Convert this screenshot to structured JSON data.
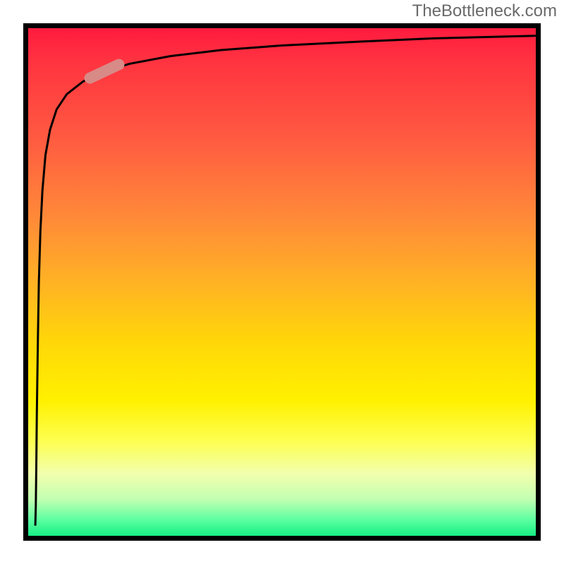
{
  "watermark": "TheBottleneck.com",
  "colors": {
    "frame": "#000000",
    "curve": "#000000",
    "marker": "#d88a87",
    "gradient_top": "#ff173e",
    "gradient_bottom": "#00e97a",
    "watermark_text": "#6a6a6a"
  },
  "chart_data": {
    "type": "line",
    "title": "",
    "xlabel": "",
    "ylabel": "",
    "xlim": [
      0,
      100
    ],
    "ylim": [
      0,
      100
    ],
    "grid": false,
    "legend": false,
    "gradient_background": {
      "direction": "vertical",
      "stops": [
        {
          "pos": 0.0,
          "color": "#ff173e"
        },
        {
          "pos": 0.07,
          "color": "#ff3240"
        },
        {
          "pos": 0.22,
          "color": "#ff5a41"
        },
        {
          "pos": 0.38,
          "color": "#ff8b38"
        },
        {
          "pos": 0.5,
          "color": "#ffb224"
        },
        {
          "pos": 0.62,
          "color": "#ffd808"
        },
        {
          "pos": 0.73,
          "color": "#fff100"
        },
        {
          "pos": 0.81,
          "color": "#fdff54"
        },
        {
          "pos": 0.87,
          "color": "#f2ffad"
        },
        {
          "pos": 0.92,
          "color": "#c2ffb2"
        },
        {
          "pos": 0.96,
          "color": "#5bffa0"
        },
        {
          "pos": 1.0,
          "color": "#00e97a"
        }
      ]
    },
    "series": [
      {
        "name": "tradeoff-curve",
        "x": [
          1.4,
          1.5,
          1.6,
          1.7,
          1.9,
          2.1,
          2.4,
          2.8,
          3.4,
          4.3,
          5.6,
          7.6,
          10.8,
          15.0,
          20.0,
          28.0,
          38.0,
          50.0,
          64.0,
          80.0,
          100.0
        ],
        "y": [
          2,
          6,
          14,
          24,
          38,
          50,
          60,
          68,
          75,
          80,
          84,
          87,
          89.5,
          91.5,
          93.0,
          94.5,
          95.7,
          96.6,
          97.3,
          98.0,
          98.5
        ]
      }
    ],
    "marker": {
      "name": "selection-pill",
      "shape": "rounded-capsule",
      "center_x": 15.0,
      "center_y": 91.5,
      "angle_deg": -25,
      "length": 8.5,
      "thickness": 2.2,
      "color": "#d88a87"
    }
  }
}
